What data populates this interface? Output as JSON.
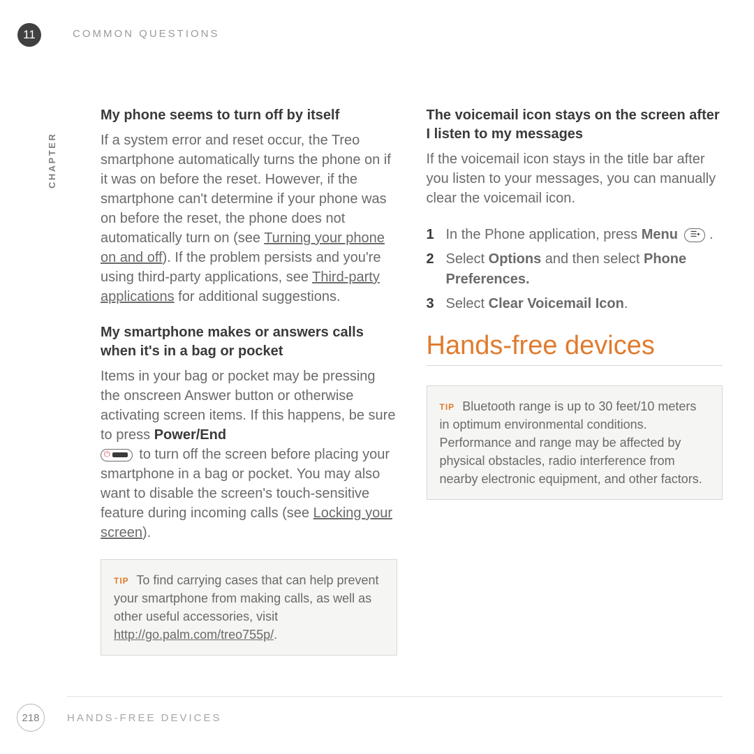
{
  "chapter": {
    "number": "11",
    "label": "CHAPTER",
    "header": "COMMON QUESTIONS"
  },
  "footer": {
    "page": "218",
    "title": "HANDS-FREE DEVICES"
  },
  "left": {
    "h1": "My phone seems to turn off by itself",
    "p1a": "If a system error and reset occur, the Treo smartphone automatically turns the phone on if it was on before the reset. However, if the smartphone can't determine if your phone was on before the reset, the phone does not automatically turn on (see ",
    "p1_link1": "Turning your phone on and off",
    "p1b": "). If the problem persists and you're using third-party applications, see ",
    "p1_link2": "Third-party applications",
    "p1c": " for additional suggestions.",
    "h2": "My smartphone makes or answers calls when it's in a bag or pocket",
    "p2a": "Items in your bag or pocket may be pressing the onscreen Answer button or otherwise activating screen items. If this happens, be sure to press ",
    "p2_bold": "Power/End",
    "p2b": " to turn off the screen before placing your smartphone in a bag or pocket. You may also want to disable the screen's touch-sensitive feature during incoming calls (see ",
    "p2_link": "Locking your screen",
    "p2c": ").",
    "tip_label": "TIP",
    "tip_a": "To find carrying cases that can help prevent your smartphone from making calls, as well as other useful accessories, visit ",
    "tip_link": "http://go.palm.com/treo755p/",
    "tip_b": "."
  },
  "right": {
    "h1": "The voicemail icon stays on the screen after I listen to my messages",
    "p1": "If the voicemail icon stays in the title bar after you listen to your messages, you can manually clear the voicemail icon.",
    "steps": [
      {
        "num": "1",
        "pre": "In the Phone application, press ",
        "bold": "Menu",
        "post": " ."
      },
      {
        "num": "2",
        "pre": "Select ",
        "bold": "Options",
        "mid": " and then select ",
        "bold2": "Phone Preferences."
      },
      {
        "num": "3",
        "pre": "Select ",
        "bold": "Clear Voicemail Icon",
        "post": "."
      }
    ],
    "section": "Hands-free devices",
    "tip_label": "TIP",
    "tip": "Bluetooth range is up to 30 feet/10 meters in optimum environmental conditions. Performance and range may be affected by physical obstacles, radio interference from nearby electronic equipment, and other factors."
  }
}
